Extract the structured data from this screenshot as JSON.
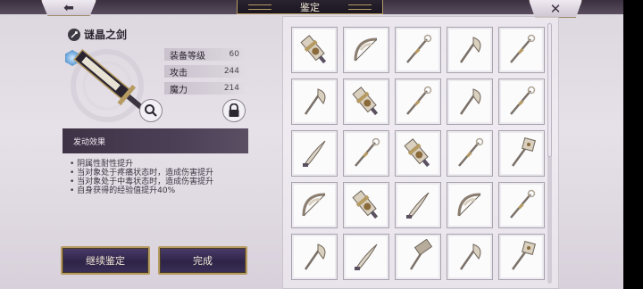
{
  "header": {
    "title": "鉴定",
    "back_symbol": "⬅",
    "close_symbol": "✕"
  },
  "item": {
    "name": "谜晶之剑",
    "type_icon": "sword-icon",
    "rank_icon": "gem-rank-icon",
    "stats": [
      {
        "label": "装备等级",
        "value": "60"
      },
      {
        "label": "攻击",
        "value": "244"
      },
      {
        "label": "魔力",
        "value": "214"
      }
    ]
  },
  "effects": {
    "header": "发动效果",
    "items": [
      "阴属性耐性提升",
      "当对象处于疼痛状态时，造成伤害提升",
      "当对象处于中毒状态时，造成伤害提升",
      "自身获得的经验值提升40%"
    ]
  },
  "buttons": {
    "continue": "继续鉴定",
    "done": "完成"
  },
  "grid": {
    "weapons": [
      "gauntlet",
      "bow",
      "spear",
      "axe",
      "spear",
      "axe",
      "gauntlet",
      "spear",
      "axe",
      "spear",
      "blade",
      "spear",
      "gauntlet",
      "spear",
      "mace",
      "bow",
      "gauntlet",
      "blade",
      "bow",
      "spear",
      "axe",
      "blade",
      "hammer",
      "axe",
      "mace"
    ]
  },
  "colors": {
    "accent_gold": "#b59a62",
    "button_purple": "#2e2447",
    "panel_dark": "#3e3346"
  }
}
